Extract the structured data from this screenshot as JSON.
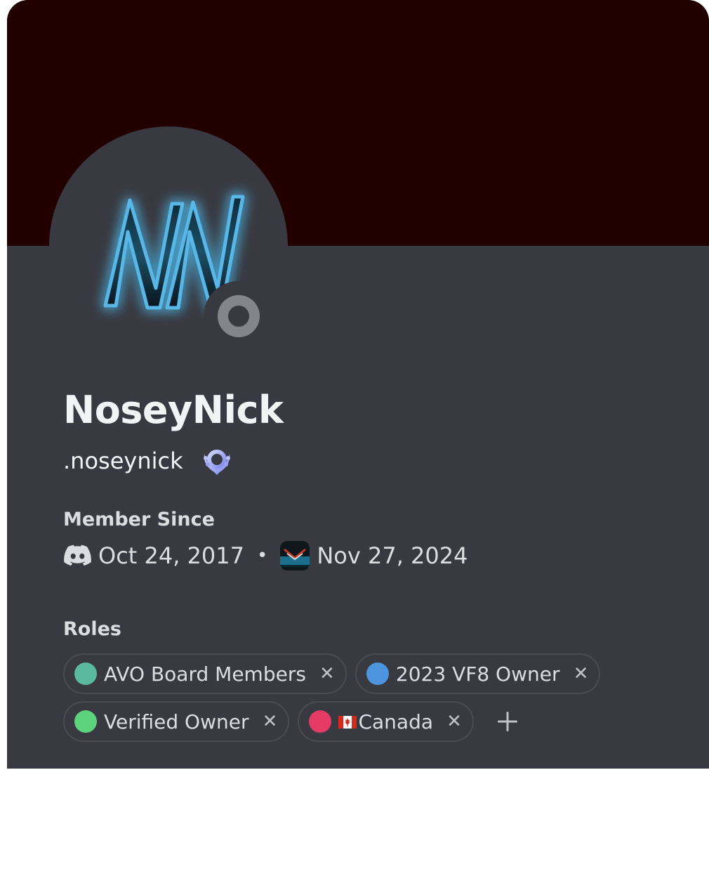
{
  "profile": {
    "display_name": "NoseyNick",
    "username": ".noseynick",
    "avatar_initials": "NN",
    "status": "offline"
  },
  "member_since": {
    "label": "Member Since",
    "discord_date": "Oct 24, 2017",
    "separator": "•",
    "server_date": "Nov 27, 2024"
  },
  "roles": {
    "label": "Roles",
    "items": [
      {
        "name": "AVO Board Members",
        "color": "#5bb9a0"
      },
      {
        "name": "2023 VF8 Owner",
        "color": "#4c95de"
      },
      {
        "name": "Verified Owner",
        "color": "#5ed37d"
      },
      {
        "name": "Canada",
        "color": "#e43a63",
        "flag": "canada-flag"
      }
    ],
    "remove_glyph": "✕",
    "add_glyph": "+"
  },
  "colors": {
    "banner": "#230000",
    "card": "#393a41",
    "text": "#f2f3f5"
  }
}
